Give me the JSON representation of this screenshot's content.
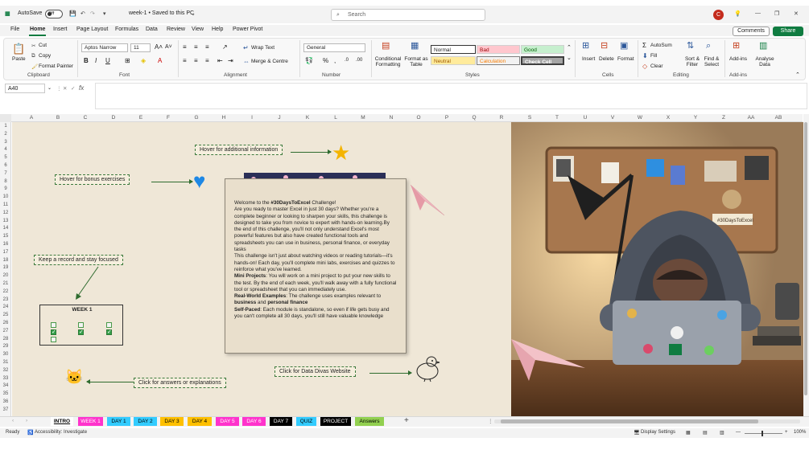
{
  "titlebar": {
    "autosave_label": "AutoSave",
    "toggle_state": "Off",
    "doc_title": "week-1 • Saved to this PC",
    "search_placeholder": "Search",
    "avatar_initial": "C"
  },
  "menu": {
    "items": [
      "File",
      "Home",
      "Insert",
      "Page Layout",
      "Formulas",
      "Data",
      "Review",
      "View",
      "Help",
      "Power Pivot"
    ],
    "comments_label": "Comments",
    "share_label": "Share"
  },
  "ribbon": {
    "clipboard": {
      "paste": "Paste",
      "cut": "Cut",
      "copy": "Copy",
      "format_painter": "Format Painter",
      "label": "Clipboard"
    },
    "font": {
      "name": "Aptos Narrow",
      "size": "11",
      "label": "Font"
    },
    "alignment": {
      "wrap": "Wrap Text",
      "merge": "Merge & Centre",
      "label": "Alignment"
    },
    "number": {
      "format": "General",
      "label": "Number"
    },
    "styles": {
      "conditional": "Conditional Formatting",
      "format_table": "Format as Table",
      "cells": [
        "Normal",
        "Bad",
        "Good",
        "Neutral",
        "Calculation",
        "Check Cell"
      ],
      "label": "Styles"
    },
    "cells": {
      "insert": "Insert",
      "delete": "Delete",
      "format": "Format",
      "label": "Cells"
    },
    "editing": {
      "autosum": "AutoSum",
      "fill": "Fill",
      "clear": "Clear",
      "sort": "Sort & Filter",
      "find": "Find & Select",
      "label": "Editing"
    },
    "addins": {
      "addins": "Add-ins",
      "analyse": "Analyse Data",
      "label": "Add-ins"
    }
  },
  "formula_bar": {
    "name_box": "A40",
    "fx": "fx",
    "value": ""
  },
  "columns": [
    "A",
    "B",
    "C",
    "D",
    "E",
    "F",
    "G",
    "H",
    "I",
    "J",
    "K",
    "L",
    "M",
    "N",
    "O",
    "P",
    "Q",
    "R",
    "S",
    "T",
    "U",
    "V",
    "W",
    "X",
    "Y",
    "Z",
    "AA",
    "AB"
  ],
  "rows": [
    "1",
    "2",
    "3",
    "4",
    "5",
    "6",
    "7",
    "8",
    "9",
    "10",
    "11",
    "12",
    "13",
    "14",
    "15",
    "16",
    "17",
    "18",
    "19",
    "20",
    "21",
    "22",
    "23",
    "24",
    "25",
    "26",
    "27",
    "28",
    "29",
    "30",
    "31",
    "32",
    "33",
    "34",
    "35",
    "36",
    "37"
  ],
  "sheet": {
    "notes": {
      "hover_info": "Hover for additional information",
      "hover_bonus": "Hover for bonus exercises",
      "keep_record": "Keep a record and stay focused",
      "click_answers": "Click for answers  or explanations",
      "click_website": "Click for Data Divas Website"
    },
    "week_box": {
      "title": "WEEK 1"
    },
    "info": {
      "p1_pre": "Welcome to the ",
      "p1_bold": "#30DaysToExcel",
      "p1_post": " Challenge!",
      "p2": "Are you ready to master Excel in just 30 days? Whether you're a complete beginner or looking to sharpen your skills, this challenge is designed to take you from novice to expert with hands-on learning.By the end of this challenge, you'll not only understand Excel's most powerful features but also have created functional tools and spreadsheets you can use in business, personal finance, or everyday tasks",
      "p3": "This challenge isn't just about watching videos or reading tutorials—it's hands-on! Each day, you'll complete mini labs, exercises and quizzes to reinforce what you've learned.",
      "p4_bold": "Mini Projects",
      "p4": ": You will work on a mini project to put your new skills to the test. By the end of each week, you'll walk away with a fully functional tool or spreadsheet that you can immediately use.",
      "p5_bold": "Real-World Examples",
      "p5": ": The challenge uses examples relevant to ",
      "p5_b2": "business",
      "p5_and": " and ",
      "p5_b3": "personal finance",
      "p6_bold": "Self-Paced",
      "p6": ": Each module is standalone, so even if life gets busy and you can't complete all 30 days, you'll still have valuable knowledge"
    },
    "photo_sticker": "#30DaysToExcel"
  },
  "tabs": [
    {
      "label": "INTRO",
      "bg": "#ffffff",
      "fg": "#000000"
    },
    {
      "label": "WEEK 1",
      "bg": "#ff33cc",
      "fg": "#ffffff"
    },
    {
      "label": "DAY 1",
      "bg": "#33ccff",
      "fg": "#000000"
    },
    {
      "label": "DAY 2",
      "bg": "#33ccff",
      "fg": "#000000"
    },
    {
      "label": "DAY 3",
      "bg": "#ffc000",
      "fg": "#000000"
    },
    {
      "label": "DAY 4",
      "bg": "#ffc000",
      "fg": "#000000"
    },
    {
      "label": "DAY 5",
      "bg": "#ff33cc",
      "fg": "#ffffff"
    },
    {
      "label": "DAY 6",
      "bg": "#ff33cc",
      "fg": "#ffffff"
    },
    {
      "label": "DAY 7",
      "bg": "#000000",
      "fg": "#ffffff"
    },
    {
      "label": "QUIZ",
      "bg": "#33ccff",
      "fg": "#000000"
    },
    {
      "label": "PROJECT",
      "bg": "#000000",
      "fg": "#ffffff"
    },
    {
      "label": "Answers",
      "bg": "#92d050",
      "fg": "#000000"
    }
  ],
  "status": {
    "ready": "Ready",
    "accessibility": "Accessibility: Investigate",
    "display": "Display Settings",
    "zoom": "100%"
  },
  "colors": {
    "excel_green": "#107c41",
    "sheet_bg": "#efe7d7",
    "note_border": "#3d7a3d"
  }
}
